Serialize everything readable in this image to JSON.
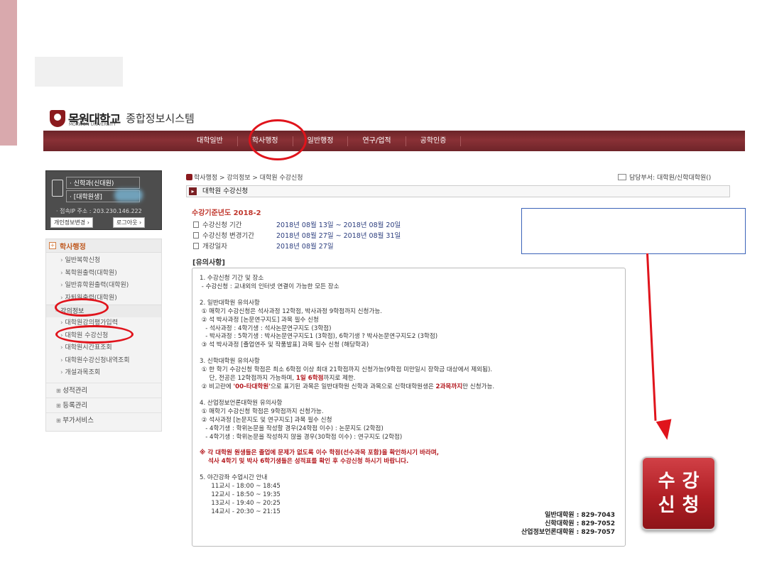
{
  "header": {
    "logo_ko": "목원대학교",
    "logo_en": "MOKWON UNIVERSITY",
    "system_name": "종합정보시스템"
  },
  "topnav": [
    "대학일반",
    "학사행정",
    "일반행정",
    "연구/업적",
    "공학인증"
  ],
  "user": {
    "dept": "· 신학과(신대원)",
    "status": "· [대학원생]",
    "ip": "· 접속IP 주소 : 203.230.146.222",
    "btn_change": "개인정보변경 ›",
    "btn_logout": "로그아웃 ›"
  },
  "sidebar": {
    "section": "학사행정",
    "items_a": [
      "일반복학신청",
      "복학원출력(대학원)",
      "일반휴학원출력(대학원)",
      "자퇴원출력(대학원)"
    ],
    "group": "강의정보",
    "items_b": [
      "대학원강의평가입력",
      "대학원 수강신청",
      "대학원시간표조회",
      "대학원수강신청내역조회",
      "개설과목조회"
    ],
    "categories": [
      "성적관리",
      "등록관리",
      "부가서비스"
    ]
  },
  "breadcrumb": "학사행정 > 강의정보 > 대학원 수강신청",
  "department": "담당부서: 대학원/신학대학원()",
  "page_title": "대학원 수강신청",
  "year_line": "수강기준년도   2018-2",
  "periods": [
    {
      "label": "수강신청 기간",
      "value": "2018년 08월 13일   ~  2018년 08월 20일"
    },
    {
      "label": "수강신청 변경기간",
      "value": "2018년 08월 27일   ~  2018년 08월 31일"
    },
    {
      "label": "개강일자",
      "value": "2018년 08월 27일"
    }
  ],
  "notice_title": "[유의사항]",
  "notice": {
    "s1": [
      "1. 수강신청 기간 및 장소",
      " - 수강신청 : 교내외의 인터넷 연결이 가능한 모든 장소"
    ],
    "s2": [
      "2. 일반대학원 유의사항",
      " ① 매학기 수강신청은 석사과정 12학점, 박사과정 9학점까지 신청가능.",
      " ② 석 박사과정 [논문연구지도] 과목 필수 신청",
      "   - 석사과정 : 4학기생 : 석사논문연구지도 (3학점)",
      "   - 박사과정 : 5학기생 : 박사논문연구지도1 (3학점), 6학기생 ? 박사논문연구지도2 (3학점)",
      " ③ 석 박사과정 [졸업연주 및 작품발표] 과목 필수 신청 (해당학과)"
    ],
    "s3_title": "3. 신학대학원 유의사항",
    "s3_line1": " ① 한 학기 수강신청 학점은 최소 6학점 이상 최대 21학점까지 신청가능(9학점 미만일시 장학금 대상에서 제외됨).",
    "s3_line2a": "     단, 전공은 12학점까지 가능하며, ",
    "s3_line2b": "1일 6학점",
    "s3_line2c": "까지로 제한.",
    "s3_line3a": " ② 비고란에 ",
    "s3_line3b": "'00-타대학원'",
    "s3_line3c": "으로 표기된 과목은 일반대학원 신학과 과목으로 신학대학원생은 ",
    "s3_line3d": "2과목까지",
    "s3_line3e": "만 신청가능.",
    "s4": [
      "4. 산업정보언론대학원 유의사항",
      " ① 매학기 수강신청 학점은 9학점까지 신청가능.",
      " ② 석사과정 [논문지도 및 연구지도] 과목 필수 신청",
      "   - 4학기생 : 학위논문을 작성할 경우(24학점 이수) : 논문지도 (2학점)",
      "   - 4학기생 : 학위논문을 작성하지 않을 경우(30학점 이수) : 연구지도 (2학점)"
    ],
    "warning": [
      "※ 각 대학원 원생들은 졸업에 문제가 없도록 이수 학점(선수과목 포함)을 확인하시기 바라며,",
      "    석사 4학기 및 박사 6학기생들은 성적표를 확인 후 수강신청 하시기 바랍니다."
    ],
    "s5": [
      "5. 야간강좌 수업시간 안내",
      "      11교시 - 18:00 ~ 18:45",
      "      12교시 - 18:50 ~ 19:35",
      "      13교시 - 19:40 ~ 20:25",
      "      14교시 - 20:30 ~ 21:15"
    ],
    "contacts": [
      "일반대학원 : 829-7043",
      "신학대학원 : 829-7052",
      "산업정보언론대학원 : 829-7057"
    ]
  },
  "big_button": [
    "수강",
    "신청"
  ],
  "colors": {
    "brand": "#8b1a1e",
    "annotation": "#e0141c",
    "highlight_box": "#3b63b8"
  }
}
